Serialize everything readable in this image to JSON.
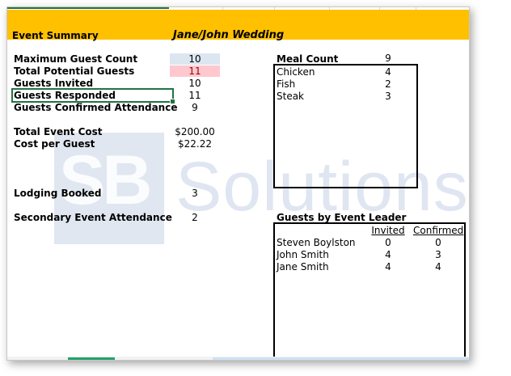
{
  "banner": {
    "label": "Event Summary",
    "event_name": "Jane/John Wedding"
  },
  "summary": {
    "max_guest_label": "Maximum Guest Count",
    "max_guest_value": "10",
    "total_potential_label": "Total Potential Guests",
    "total_potential_value": "11",
    "invited_label": "Guests Invited",
    "invited_value": "10",
    "responded_label": "Guests Responded",
    "responded_value": "11",
    "confirmed_label": "Guests Confirmed Attendance",
    "confirmed_value": "9",
    "total_cost_label": "Total Event Cost",
    "total_cost_value": "$200.00",
    "cost_per_guest_label": "Cost per Guest",
    "cost_per_guest_value": "$22.22",
    "lodging_label": "Lodging Booked",
    "lodging_value": "3",
    "secondary_label": "Secondary Event Attendance",
    "secondary_value": "2"
  },
  "meal": {
    "title": "Meal Count",
    "total": "9",
    "items": [
      {
        "name": "Chicken",
        "count": "4"
      },
      {
        "name": "Fish",
        "count": "2"
      },
      {
        "name": "Steak",
        "count": "3"
      }
    ]
  },
  "leaders": {
    "title": "Guests by Event Leader",
    "col_invited": "Invited",
    "col_confirmed": "Confirmed",
    "rows": [
      {
        "name": "Steven Boylston",
        "invited": "0",
        "confirmed": "0"
      },
      {
        "name": "John Smith",
        "invited": "4",
        "confirmed": "3"
      },
      {
        "name": "Jane Smith",
        "invited": "4",
        "confirmed": "4"
      }
    ]
  },
  "watermark": {
    "logo": "SB",
    "word": "Solutions"
  },
  "colors": {
    "banner": "#ffc000",
    "highlight_blue": "#dce6f1",
    "highlight_pink": "#ffc7ce",
    "excel_green": "#217346"
  }
}
